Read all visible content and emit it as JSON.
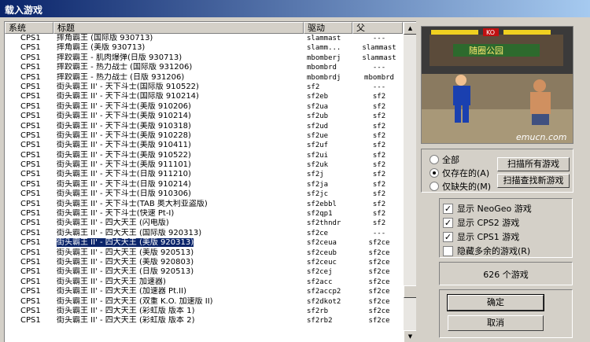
{
  "window": {
    "title": "载入游戏"
  },
  "columns": [
    "系统",
    "标题",
    "驱动",
    "父"
  ],
  "rows": [
    [
      "CPS1",
      "摔角霸王 (国际版 930713)",
      "slammast",
      "---"
    ],
    [
      "CPS1",
      "摔角霸王 (美版 930713)",
      "slamm...",
      "slammast"
    ],
    [
      "CPS1",
      "摔跤霸王 - 肌肉爆弹(日版 930713)",
      "mbomberj",
      "slammast"
    ],
    [
      "CPS1",
      "摔跤霸王 - 热力战士 (国际版 931206)",
      "mbombrd",
      "---"
    ],
    [
      "CPS1",
      "摔跤霸王 - 热力战士 (日版 931206)",
      "mbombrdj",
      "mbombrd"
    ],
    [
      "CPS1",
      "街头霸王 II' - 天下斗士(国际版 910522)",
      "sf2",
      "---"
    ],
    [
      "CPS1",
      "街头霸王 II' - 天下斗士(国际版 910214)",
      "sf2eb",
      "sf2"
    ],
    [
      "CPS1",
      "街头霸王 II' - 天下斗士(美版 910206)",
      "sf2ua",
      "sf2"
    ],
    [
      "CPS1",
      "街头霸王 II' - 天下斗士(美版 910214)",
      "sf2ub",
      "sf2"
    ],
    [
      "CPS1",
      "街头霸王 II' - 天下斗士(美版 910318)",
      "sf2ud",
      "sf2"
    ],
    [
      "CPS1",
      "街头霸王 II' - 天下斗士(美版 910228)",
      "sf2ue",
      "sf2"
    ],
    [
      "CPS1",
      "街头霸王 II' - 天下斗士(美版 910411)",
      "sf2uf",
      "sf2"
    ],
    [
      "CPS1",
      "街头霸王 II' - 天下斗士(美版 910522)",
      "sf2ui",
      "sf2"
    ],
    [
      "CPS1",
      "街头霸王 II' - 天下斗士(美版 911101)",
      "sf2uk",
      "sf2"
    ],
    [
      "CPS1",
      "街头霸王 II' - 天下斗士(日版 911210)",
      "sf2j",
      "sf2"
    ],
    [
      "CPS1",
      "街头霸王 II' - 天下斗士(日版 910214)",
      "sf2ja",
      "sf2"
    ],
    [
      "CPS1",
      "街头霸王 II' - 天下斗士(日版 910306)",
      "sf2jc",
      "sf2"
    ],
    [
      "CPS1",
      "街头霸王 II' - 天下斗士(TAB 奥大利亚盗版)",
      "sf2ebbl",
      "sf2"
    ],
    [
      "CPS1",
      "街头霸王 II' - 天下斗士(快速 Pt-I)",
      "sf2qp1",
      "sf2"
    ],
    [
      "CPS1",
      "街头霸王 II' - 四大天王 (闪电版)",
      "sf2thndr",
      "sf2"
    ],
    [
      "CPS1",
      "街头霸王 II' - 四大天王 (国际版 920313)",
      "sf2ce",
      "---"
    ],
    [
      "CPS1",
      "街头霸王 II' - 四大天王 (美版 920313)",
      "sf2ceua",
      "sf2ce"
    ],
    [
      "CPS1",
      "街头霸王 II' - 四大天王 (美版 920513)",
      "sf2ceub",
      "sf2ce"
    ],
    [
      "CPS1",
      "街头霸王 II' - 四大天王 (美版 920803)",
      "sf2ceuc",
      "sf2ce"
    ],
    [
      "CPS1",
      "街头霸王 II' - 四大天王 (日版 920513)",
      "sf2cej",
      "sf2ce"
    ],
    [
      "CPS1",
      "街头霸王 II' - 四大天王 加速器)",
      "sf2acc",
      "sf2ce"
    ],
    [
      "CPS1",
      "街头霸王 II' - 四大天王 (加速器 Pt.II)",
      "sf2accp2",
      "sf2ce"
    ],
    [
      "CPS1",
      "街头霸王 II' - 四大天王 (双重 K.O. 加速版 II)",
      "sf2dkot2",
      "sf2ce"
    ],
    [
      "CPS1",
      "街头霸王 II' - 四大天王 (彩虹版 版本 1)",
      "sf2rb",
      "sf2ce"
    ],
    [
      "CPS1",
      "街头霸王 II' - 四大天王 (彩虹版 版本 2)",
      "sf2rb2",
      "sf2ce"
    ]
  ],
  "selected_index": 21,
  "preview": {
    "watermark": "emucn.com",
    "sign_text": "随圈公园",
    "hud": "KO"
  },
  "filter": {
    "options": [
      "全部",
      "仅存在的(A)",
      "仅缺失的(M)"
    ],
    "selected": 1,
    "scan_all": "扫描所有游戏",
    "scan_new": "扫描查找新游戏"
  },
  "options": [
    {
      "label": "显示 NeoGeo 游戏",
      "checked": true
    },
    {
      "label": "显示 CPS2 游戏",
      "checked": true
    },
    {
      "label": "显示 CPS1 游戏",
      "checked": true
    },
    {
      "label": "隐藏多余的游戏(R)",
      "checked": false
    }
  ],
  "count_text": "626 个游戏",
  "ok_label": "确定",
  "cancel_label": "取消"
}
